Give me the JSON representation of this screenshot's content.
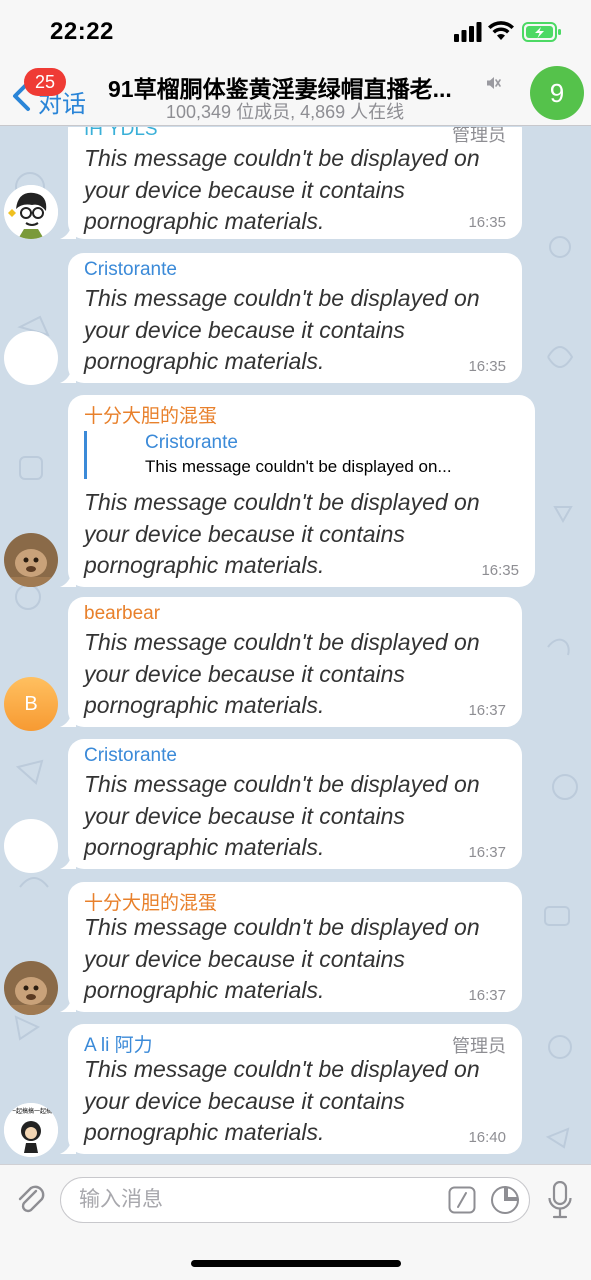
{
  "status_bar": {
    "time": "22:22",
    "icons": [
      "signal-icon",
      "wifi-icon",
      "battery-charging-icon"
    ],
    "battery_color": "#4cd964"
  },
  "header": {
    "back_label": "对话",
    "unread_badge": "25",
    "title": "91草榴胴体鉴黄淫妻绿帽直播老...",
    "subtitle": "100,349 位成员, 4,869 人在线",
    "group_avatar_letter": "9",
    "group_avatar_color": "#55c24b",
    "accent_color": "#2a85d8"
  },
  "messages": [
    {
      "sender": "IH YDLS",
      "sender_color": "#3ab0d8",
      "role": "管理员",
      "text": "This message couldn't be displayed on your device because it contains pornographic materials.",
      "time": "16:35"
    },
    {
      "sender": "Cristorante",
      "sender_color": "#3b8ad8",
      "text": "This message couldn't be displayed on your device because it contains pornographic materials.",
      "time": "16:35"
    },
    {
      "sender": "十分大胆的混蛋",
      "sender_color": "#e8802b",
      "reply": {
        "sender": "Cristorante",
        "text": "This message couldn't be displayed on..."
      },
      "text": "This message couldn't be displayed on your device because it contains pornographic materials.",
      "time": "16:35"
    },
    {
      "sender": "bearbear",
      "sender_color": "#e8802b",
      "avatar_letter": "B",
      "text": "This message couldn't be displayed on your device because it contains pornographic materials.",
      "time": "16:37"
    },
    {
      "sender": "Cristorante",
      "sender_color": "#3b8ad8",
      "text": "This message couldn't be displayed on your device because it contains pornographic materials.",
      "time": "16:37"
    },
    {
      "sender": "十分大胆的混蛋",
      "sender_color": "#e8802b",
      "text": "This message couldn't be displayed on your device because it contains pornographic materials.",
      "time": "16:37"
    },
    {
      "sender": "A li 阿力",
      "sender_color": "#3b8ad8",
      "role": "管理员",
      "avatar_caption": "一起搞搞一起搞",
      "text": "This message couldn't be displayed on your device because it contains pornographic materials.",
      "time": "16:40"
    }
  ],
  "input_bar": {
    "placeholder": "输入消息",
    "icons": [
      "paperclip-icon",
      "command-icon",
      "sticker-icon",
      "microphone-icon"
    ]
  }
}
